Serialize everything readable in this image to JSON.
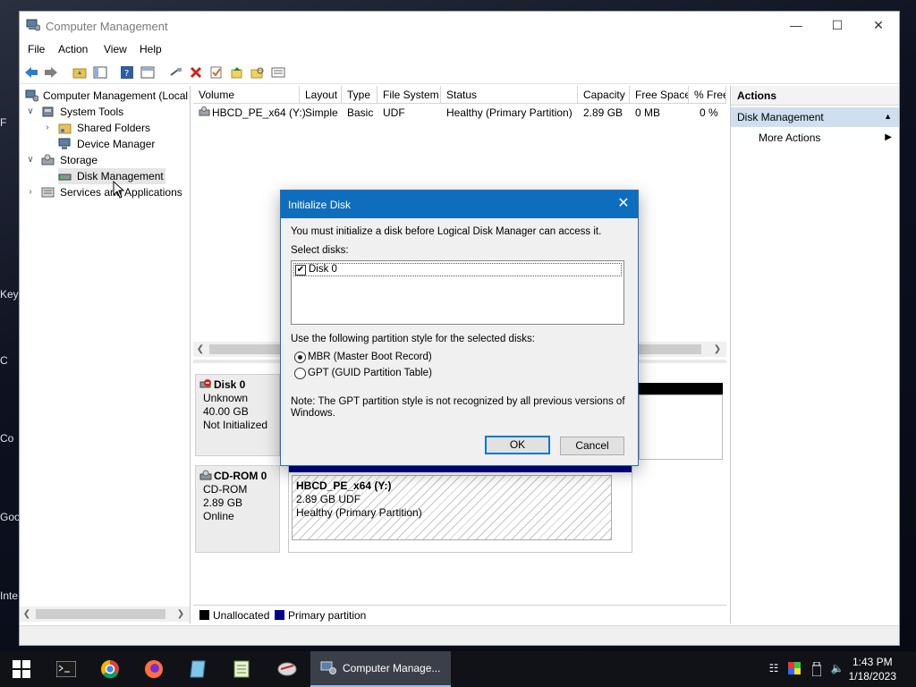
{
  "desktop": {
    "fragments": [
      "F",
      "Key",
      "C",
      "Co",
      "Goo",
      "Inte"
    ]
  },
  "window": {
    "title": "Computer Management",
    "controls": {
      "minimize": "—",
      "maximize": "☐",
      "close": "✕"
    }
  },
  "menu": [
    "File",
    "Action",
    "View",
    "Help"
  ],
  "tree": {
    "root": "Computer Management (Local",
    "system_tools": "System Tools",
    "shared_folders": "Shared Folders",
    "device_manager": "Device Manager",
    "storage": "Storage",
    "disk_management": "Disk Management",
    "services": "Services and Applications"
  },
  "volume_table": {
    "columns": [
      "Volume",
      "Layout",
      "Type",
      "File System",
      "Status",
      "Capacity",
      "Free Space",
      "% Free"
    ],
    "rows": [
      [
        "HBCD_PE_x64 (Y:)",
        "Simple",
        "Basic",
        "UDF",
        "Healthy (Primary Partition)",
        "2.89 GB",
        "0 MB",
        "0 %"
      ]
    ]
  },
  "disks": {
    "disk0": {
      "name": "Disk 0",
      "type": "Unknown",
      "size": "40.00 GB",
      "status": "Not Initialized"
    },
    "cdrom0": {
      "name": "CD-ROM 0",
      "type": "CD-ROM",
      "size": "2.89 GB",
      "status": "Online",
      "partition": {
        "label": "HBCD_PE_x64  (Y:)",
        "size_fs": "2.89 GB UDF",
        "status": "Healthy (Primary Partition)"
      }
    }
  },
  "legend": {
    "unallocated": "Unallocated",
    "primary": "Primary partition",
    "unallocated_color": "#000000",
    "primary_color": "#00008b"
  },
  "actions": {
    "header": "Actions",
    "section": "Disk Management",
    "more": "More Actions"
  },
  "dialog": {
    "title": "Initialize Disk",
    "intro": "You must initialize a disk before Logical Disk Manager can access it.",
    "select_label": "Select disks:",
    "disks": [
      {
        "label": "Disk 0",
        "checked": true
      }
    ],
    "style_label": "Use the following partition style for the selected disks:",
    "mbr": "MBR (Master Boot Record)",
    "gpt": "GPT (GUID Partition Table)",
    "selected_style": "MBR",
    "note_line1": "Note: The GPT partition style is not recognized by all previous versions of",
    "note_line2": "Windows.",
    "ok": "OK",
    "cancel": "Cancel"
  },
  "taskbar": {
    "active_app": "Computer Manage...",
    "time": "1:43 PM",
    "date": "1/18/2023"
  },
  "colors": {
    "dialog_title": "#0e6ebd",
    "selection": "#cfdff0",
    "accent": "#0078d7"
  }
}
